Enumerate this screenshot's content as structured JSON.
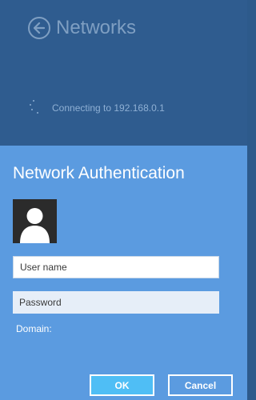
{
  "header": {
    "title": "Networks",
    "back_icon": "back-arrow-icon"
  },
  "status": {
    "text": "Connecting to 192.168.0.1",
    "icon": "loading-spinner-icon"
  },
  "auth": {
    "title": "Network Authentication",
    "avatar_icon": "user-avatar-icon",
    "username_placeholder": "User name",
    "password_placeholder": "Password",
    "domain_label": "Domain:",
    "ok_label": "OK",
    "cancel_label": "Cancel"
  },
  "colors": {
    "top_background": "#2f5c8f",
    "auth_background": "#5b9be0",
    "ok_button": "#4fbef5",
    "avatar_background": "#2b2b2b"
  }
}
